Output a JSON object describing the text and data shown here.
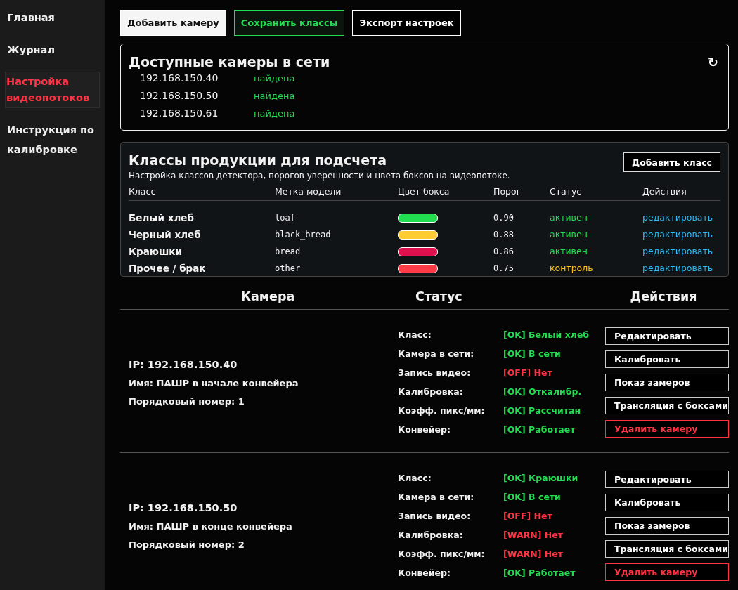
{
  "sidebar": {
    "items": [
      {
        "label": "Главная",
        "selected": false
      },
      {
        "label": "Журнал",
        "selected": false
      },
      {
        "label": "Настройка видеопотоков",
        "selected": true
      },
      {
        "label": "Инструкция по калибровке",
        "selected": false
      }
    ]
  },
  "toolbar": {
    "buttons": [
      {
        "label": "Добавить камеру",
        "kind": "primary"
      },
      {
        "label": "Сохранить классы",
        "kind": "success"
      },
      {
        "label": "Экспорт настроек",
        "kind": "plain"
      }
    ]
  },
  "network_cameras": {
    "title": "Доступные камеры в сети",
    "refresh": "↻",
    "items": [
      {
        "ip": "192.168.150.40",
        "status": "найдена"
      },
      {
        "ip": "192.168.150.50",
        "status": "найдена"
      },
      {
        "ip": "192.168.150.61",
        "status": "найдена"
      }
    ]
  },
  "classes": {
    "title": "Классы продукции для подсчета",
    "subtitle": "Настройка классов детектора, порогов уверенности и цвета боксов на видеопотоке.",
    "add_button": "Добавить класс",
    "columns": [
      "Класс",
      "Метка модели",
      "Цвет бокса",
      "Порог",
      "Статус",
      "Действия"
    ],
    "rows": [
      {
        "name": "Белый хлеб",
        "label": "loaf",
        "color": "#22dd4f",
        "threshold": "0.90",
        "status": "активен",
        "kind": "active",
        "action": "редактировать"
      },
      {
        "name": "Черный хлеб",
        "label": "black_bread",
        "color": "#ffcc33",
        "threshold": "0.88",
        "status": "активен",
        "kind": "active",
        "action": "редактировать"
      },
      {
        "name": "Краюшки",
        "label": "bread",
        "color": "#e0104f",
        "threshold": "0.86",
        "status": "активен",
        "kind": "active",
        "action": "редактировать"
      },
      {
        "name": "Прочее / брак",
        "label": "other",
        "color": "#ff3b47",
        "threshold": "0.75",
        "status": "контроль",
        "kind": "warn",
        "action": "редактировать"
      }
    ]
  },
  "cameras": {
    "columns": [
      "Камера",
      "Статус",
      "Действия"
    ],
    "rows": [
      {
        "ip": "IP: 192.168.150.40",
        "name": "Имя: ПАШР в начале конвейера",
        "order": "Порядковый номер: 1",
        "statuses": [
          {
            "label": "Класс:",
            "value": "[OK] Белый хлеб",
            "kind": "ok"
          },
          {
            "label": "Камера в сети:",
            "value": "[OK] В сети",
            "kind": "ok"
          },
          {
            "label": "Запись видео:",
            "value": "[OFF] Нет",
            "kind": "bad"
          },
          {
            "label": "Калибровка:",
            "value": "[OK] Откалибр.",
            "kind": "ok"
          },
          {
            "label": "Коэфф. пикс/мм:",
            "value": "[OK] Рассчитан",
            "kind": "ok"
          },
          {
            "label": "Конвейер:",
            "value": "[OK] Работает",
            "kind": "ok"
          }
        ],
        "actions": [
          {
            "label": "Редактировать",
            "kind": "plain"
          },
          {
            "label": "Калибровать",
            "kind": "plain"
          },
          {
            "label": "Показ замеров",
            "kind": "plain"
          },
          {
            "label": "Трансляция с боксами",
            "kind": "plain"
          },
          {
            "label": "Удалить камеру",
            "kind": "danger"
          }
        ]
      },
      {
        "ip": "IP: 192.168.150.50",
        "name": "Имя: ПАШР в конце конвейера",
        "order": "Порядковый номер: 2",
        "statuses": [
          {
            "label": "Класс:",
            "value": "[OK] Краюшки",
            "kind": "ok"
          },
          {
            "label": "Камера в сети:",
            "value": "[OK] В сети",
            "kind": "ok"
          },
          {
            "label": "Запись видео:",
            "value": "[OFF] Нет",
            "kind": "bad"
          },
          {
            "label": "Калибровка:",
            "value": "[WARN] Нет",
            "kind": "bad"
          },
          {
            "label": "Коэфф. пикс/мм:",
            "value": "[WARN] Нет",
            "kind": "bad"
          },
          {
            "label": "Конвейер:",
            "value": "[OK] Работает",
            "kind": "ok"
          }
        ],
        "actions": [
          {
            "label": "Редактировать",
            "kind": "plain"
          },
          {
            "label": "Калибровать",
            "kind": "plain"
          },
          {
            "label": "Показ замеров",
            "kind": "plain"
          },
          {
            "label": "Трансляция с боксами",
            "kind": "plain"
          },
          {
            "label": "Удалить камеру",
            "kind": "danger"
          }
        ]
      }
    ]
  }
}
